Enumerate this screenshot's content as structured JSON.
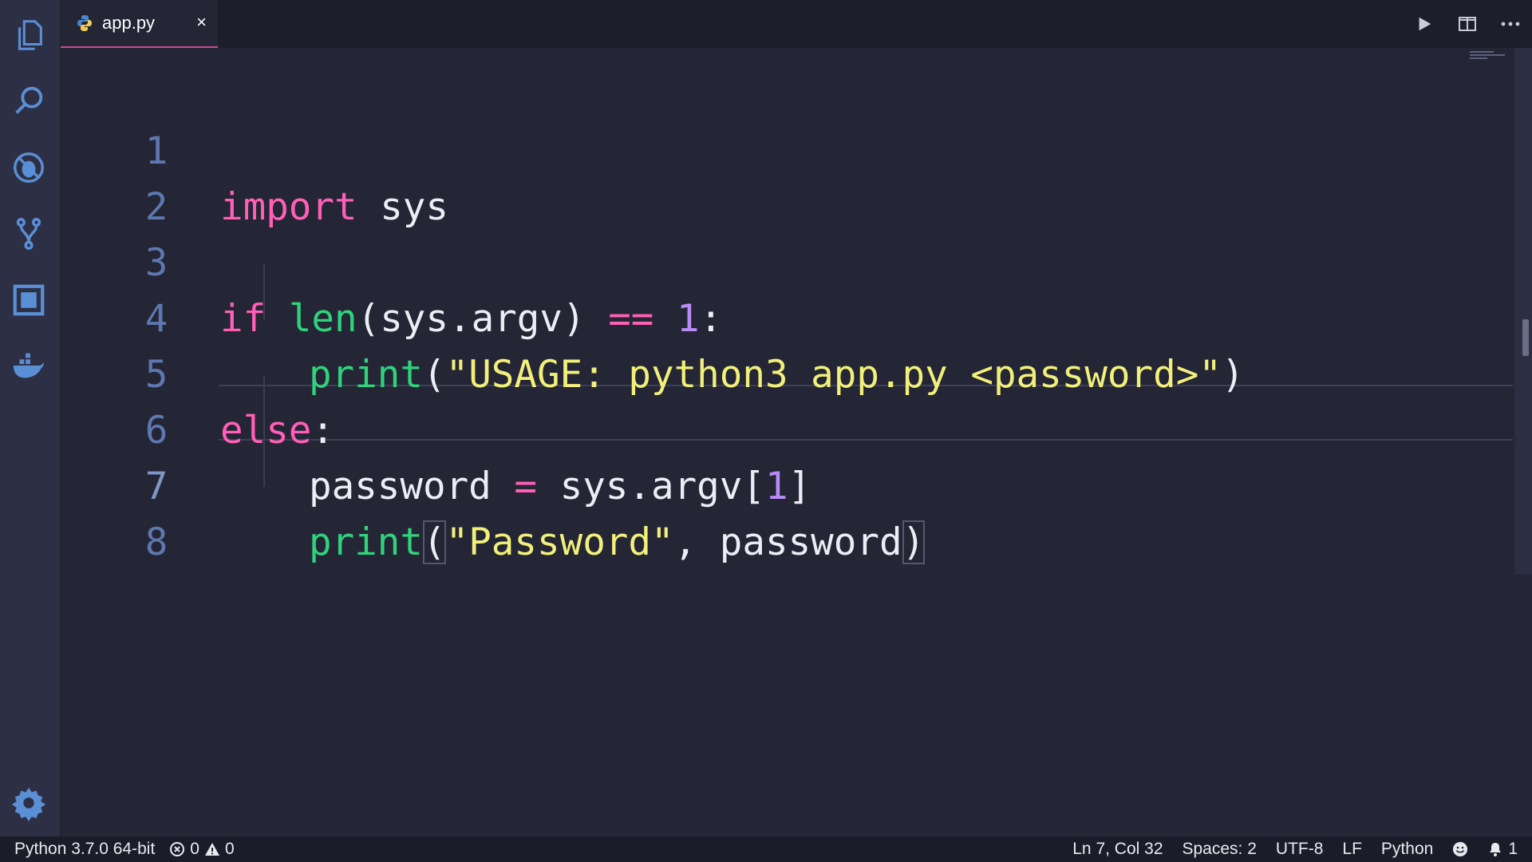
{
  "tab": {
    "title": "app.py",
    "close": "×"
  },
  "code_lines": [
    {
      "num": "1"
    },
    {
      "num": "2"
    },
    {
      "num": "3"
    },
    {
      "num": "4"
    },
    {
      "num": "5"
    },
    {
      "num": "6"
    },
    {
      "num": "7"
    },
    {
      "num": "8"
    }
  ],
  "tokens": {
    "l1": [
      "import",
      " sys"
    ],
    "l3": [
      "if",
      " ",
      "len",
      "(sys.argv) ",
      "==",
      " ",
      "1",
      ":"
    ],
    "l4": [
      "print",
      "(",
      "\"USAGE: python3 app.py <password>\"",
      ")"
    ],
    "l5": [
      "else",
      ":"
    ],
    "l6": [
      "password ",
      "=",
      " sys.argv[",
      "1",
      "]"
    ],
    "l7": [
      "print",
      "(",
      "\"Password\"",
      ", password",
      ")"
    ]
  },
  "status": {
    "interpreter": "Python 3.7.0 64-bit",
    "errors": "0",
    "warnings": "0",
    "position": "Ln 7, Col 32",
    "spaces": "Spaces: 2",
    "encoding": "UTF-8",
    "eol": "LF",
    "language": "Python",
    "notifications": "1"
  },
  "colors": {
    "keyword": "#ff5fb7",
    "function": "#30d27c",
    "number": "#b88cf7",
    "string": "#f2f07a",
    "line_number": "#5d78b0",
    "tab_accent": "#c94a8f",
    "activity_icons": "#5a8fd6"
  }
}
